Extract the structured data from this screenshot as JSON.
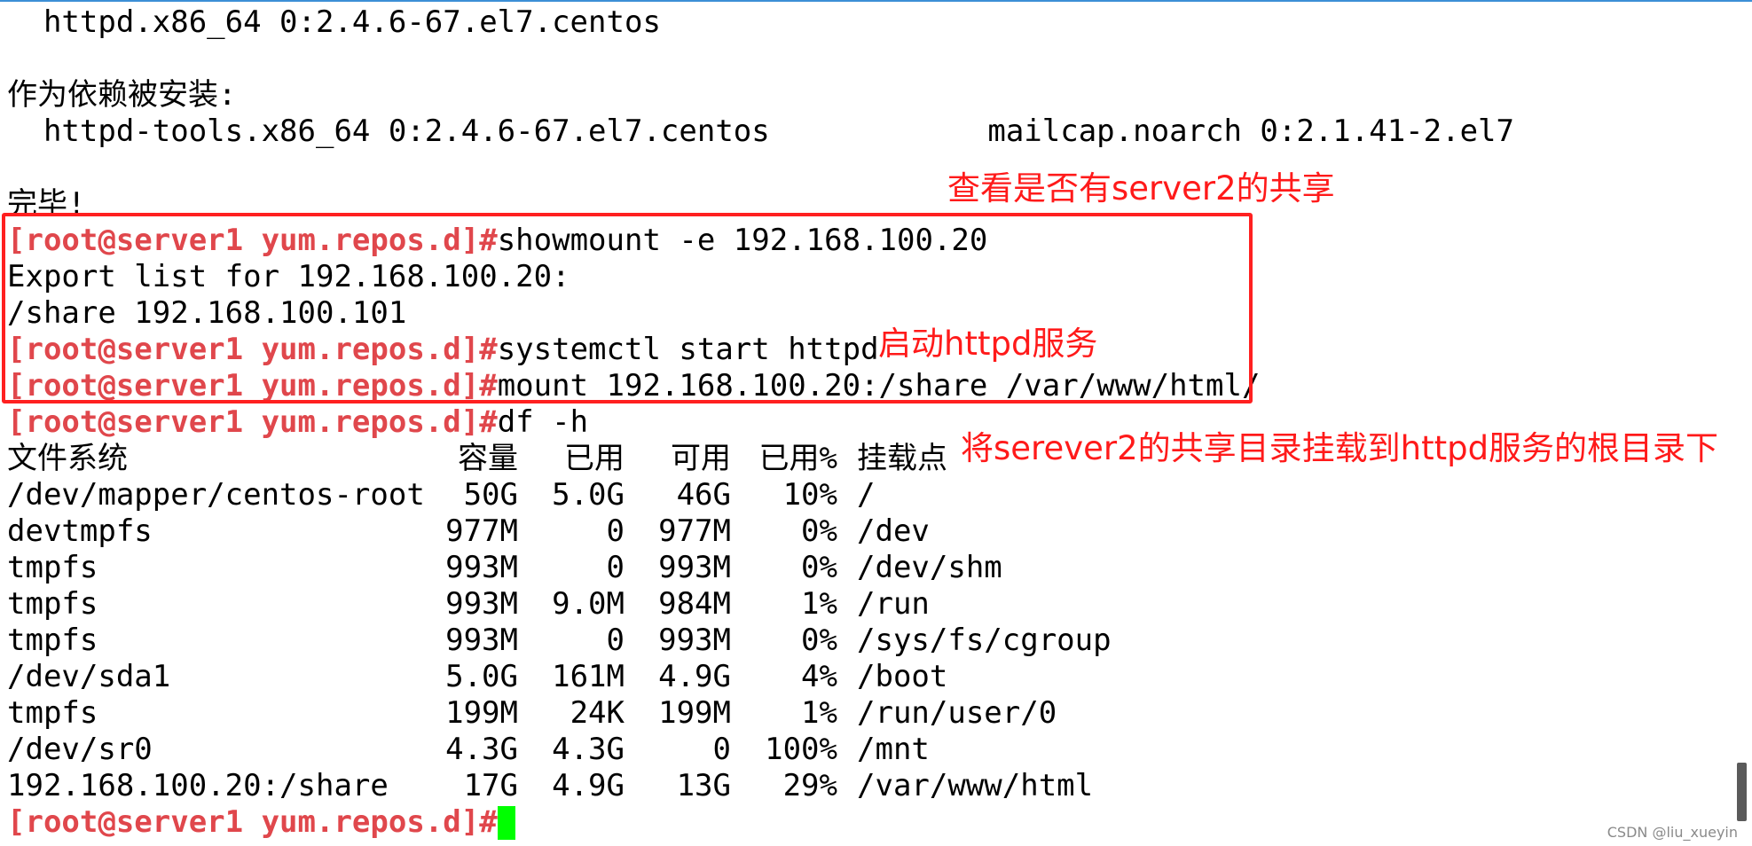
{
  "terminal": {
    "lines": [
      "  httpd.x86_64 0:2.4.6-67.el7.centos",
      "作为依赖被安装:",
      "  httpd-tools.x86_64 0:2.4.6-67.el7.centos            mailcap.noarch 0:2.1.41-2.el7",
      "完毕!"
    ],
    "prompt": "[root@server1 yum.repos.d]#",
    "commands": [
      "showmount -e 192.168.100.20",
      "systemctl start httpd",
      "mount 192.168.100.20:/share /var/www/html/",
      "df -h"
    ],
    "outputs": {
      "export_header": "Export list for 192.168.100.20:",
      "export_entry": "/share 192.168.100.101"
    }
  },
  "df_table": {
    "headers": [
      "文件系统",
      "容量",
      "已用",
      "可用",
      "已用%",
      "挂载点"
    ],
    "rows": [
      [
        "/dev/mapper/centos-root",
        "50G",
        "5.0G",
        "46G",
        "10%",
        "/"
      ],
      [
        "devtmpfs",
        "977M",
        "0",
        "977M",
        "0%",
        "/dev"
      ],
      [
        "tmpfs",
        "993M",
        "0",
        "993M",
        "0%",
        "/dev/shm"
      ],
      [
        "tmpfs",
        "993M",
        "9.0M",
        "984M",
        "1%",
        "/run"
      ],
      [
        "tmpfs",
        "993M",
        "0",
        "993M",
        "0%",
        "/sys/fs/cgroup"
      ],
      [
        "/dev/sda1",
        "5.0G",
        "161M",
        "4.9G",
        "4%",
        "/boot"
      ],
      [
        "tmpfs",
        "199M",
        "24K",
        "199M",
        "1%",
        "/run/user/0"
      ],
      [
        "/dev/sr0",
        "4.3G",
        "4.3G",
        "0",
        "100%",
        "/mnt"
      ],
      [
        "192.168.100.20:/share",
        "17G",
        "4.9G",
        "13G",
        "29%",
        "/var/www/html"
      ]
    ]
  },
  "annotations": {
    "check_share": "查看是否有server2的共享",
    "start_httpd": "启动httpd服务",
    "mount_share": "将serever2的共享目录挂载到httpd服务的根目录下"
  },
  "watermark": "CSDN @liu_xueyin",
  "colors": {
    "prompt": "#e0474c",
    "annotation": "#ff1a1a",
    "cursor": "#00ff00",
    "box": "#ff2020"
  }
}
